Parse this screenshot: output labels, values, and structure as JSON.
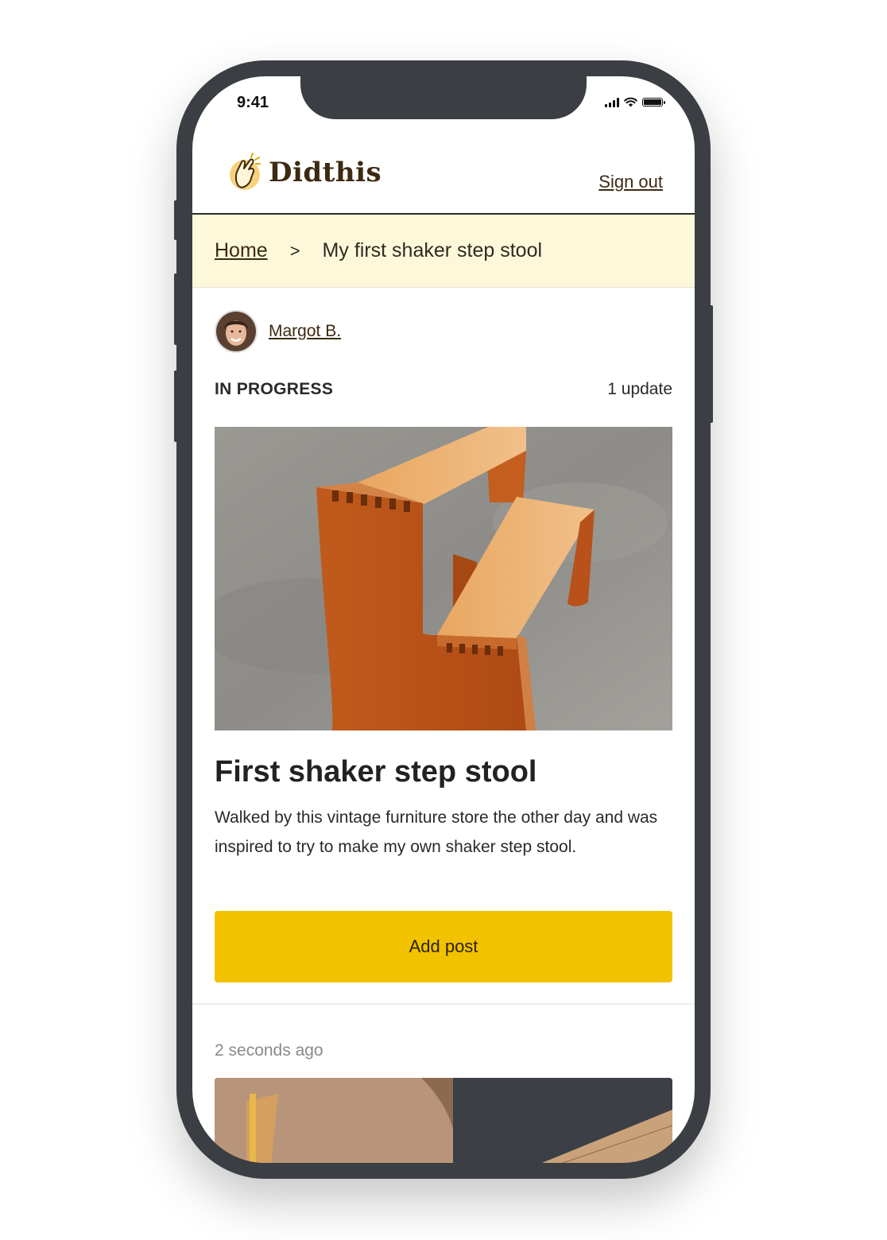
{
  "status_bar": {
    "time": "9:41"
  },
  "header": {
    "brand": "Didthis",
    "signout_label": "Sign out"
  },
  "breadcrumb": {
    "home": "Home",
    "separator": ">",
    "current": "My first shaker step stool"
  },
  "project": {
    "author": "Margot B.",
    "status": "IN PROGRESS",
    "update_count": "1 update",
    "title": "First shaker step stool",
    "description": "Walked by this vintage furniture store the other day and was inspired to try to make my own shaker step stool.",
    "add_post_label": "Add post"
  },
  "post": {
    "timestamp": "2 seconds ago"
  },
  "colors": {
    "accent": "#f2c200",
    "breadcrumb_bg": "#fef8da",
    "brand_text": "#3d2a12",
    "frame": "#3b3e42"
  }
}
